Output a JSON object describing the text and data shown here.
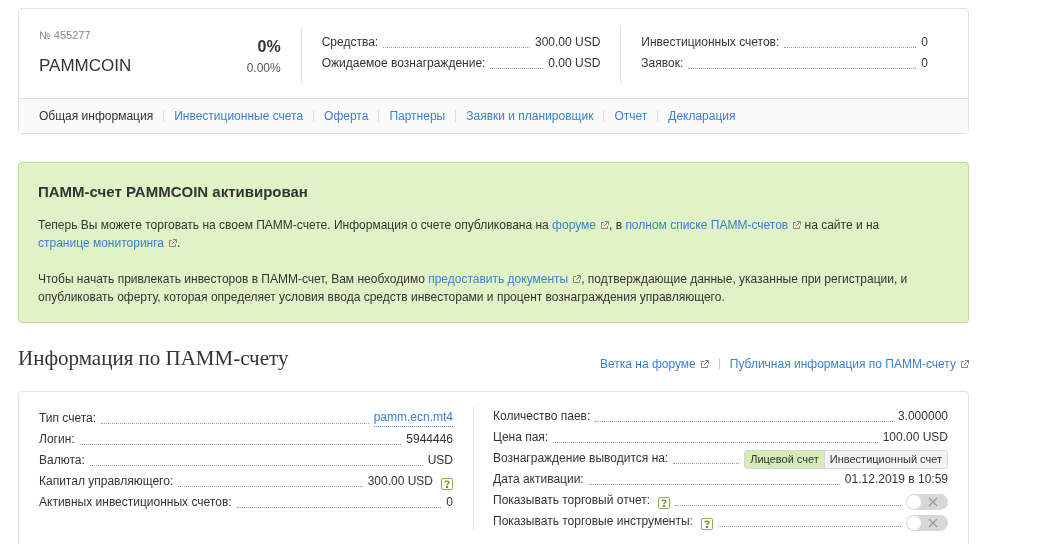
{
  "account": {
    "number": "№ 455277",
    "name": "PAMMCOIN",
    "percent": "0%",
    "percent_sub": "0.00%"
  },
  "summary_1": [
    {
      "label": "Средства:",
      "value": "300.00 USD"
    },
    {
      "label": "Ожидаемое вознаграждение:",
      "value": "0.00 USD"
    }
  ],
  "summary_2": [
    {
      "label": "Инвестиционных счетов:",
      "value": "0"
    },
    {
      "label": "Заявок:",
      "value": "0"
    }
  ],
  "tabs": [
    {
      "label": "Общая информация",
      "selected": true
    },
    {
      "label": "Инвестиционные счета",
      "selected": false
    },
    {
      "label": "Оферта",
      "selected": false
    },
    {
      "label": "Партнеры",
      "selected": false
    },
    {
      "label": "Заявки и планировщик",
      "selected": false
    },
    {
      "label": "Отчет",
      "selected": false
    },
    {
      "label": "Декларация",
      "selected": false
    }
  ],
  "notice": {
    "title": "ПАММ-счет PAMMCOIN активирован",
    "paragraphs": [
      [
        {
          "text": "Теперь Вы можете торговать на своем ПАММ-счете. Информация о счете опубликована на ",
          "link": false
        },
        {
          "text": "форуме",
          "link": true
        },
        {
          "text": ", в ",
          "link": false
        },
        {
          "text": "полном списке ПАММ-счетов",
          "link": true
        },
        {
          "text": " на сайте и на ",
          "link": false
        },
        {
          "text": "странице мониторинга",
          "link": true
        },
        {
          "text": ".",
          "link": false
        }
      ],
      [
        {
          "text": "Чтобы начать привлекать инвесторов в ПАММ-счет, Вам необходимо ",
          "link": false
        },
        {
          "text": "предоставить документы",
          "link": true
        },
        {
          "text": ", подтверждающие данные, указанные при регистрации, и опубликовать оферту, которая определяет условия ввода средств инвесторами и процент вознаграждения управляющего.",
          "link": false
        }
      ]
    ]
  },
  "info": {
    "title": "Информация по ПАММ-счету",
    "links": [
      "Ветка на форуме",
      "Публичная информация по ПАММ-счету"
    ],
    "left": [
      {
        "kind": "link",
        "label": "Тип счета:",
        "value": "pamm.ecn.mt4"
      },
      {
        "kind": "value",
        "label": "Логин:",
        "value": "5944446"
      },
      {
        "kind": "value",
        "label": "Валюта:",
        "value": "USD"
      },
      {
        "kind": "value",
        "label": "Капитал управляющего:",
        "value": "300.00 USD",
        "help": true
      },
      {
        "kind": "value",
        "label": "Активных инвестиционных счетов:",
        "value": "0"
      }
    ],
    "right": [
      {
        "kind": "value",
        "label": "Количество паев:",
        "value": "3.000000"
      },
      {
        "kind": "value",
        "label": "Цена пая:",
        "value": "100.00 USD"
      },
      {
        "kind": "segmented",
        "label": "Вознаграждение выводится на:",
        "options": [
          {
            "label": "Лицевой счет",
            "selected": true
          },
          {
            "label": "Инвестиционный счет",
            "selected": false
          }
        ]
      },
      {
        "kind": "value",
        "label": "Дата активации:",
        "value": "01.12.2019 в 10:59"
      },
      {
        "kind": "toggle",
        "label": "Показывать торговый отчет:",
        "help": true,
        "on": false
      },
      {
        "kind": "toggle",
        "label": "Показывать торговые инструменты:",
        "help": true,
        "on": false
      }
    ]
  }
}
